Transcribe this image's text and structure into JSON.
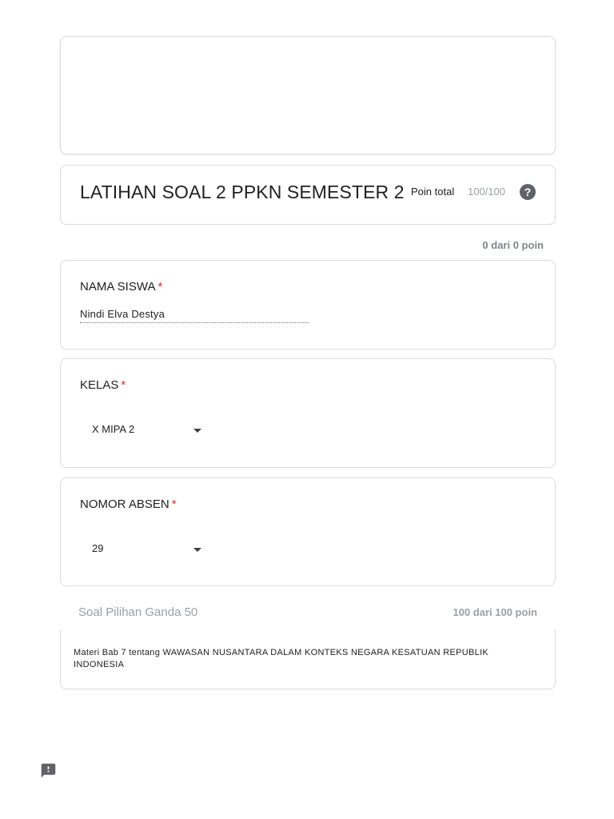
{
  "form": {
    "title": "LATIHAN SOAL 2 PPKN SEMESTER 2",
    "points_label": "Poin total",
    "points_value": "100/100",
    "help_glyph": "?",
    "score_summary": "0 dari 0 poin"
  },
  "questions": [
    {
      "title": "NAMA SISWA",
      "required_mark": "*",
      "type": "text",
      "answer": "Nindi Elva Destya"
    },
    {
      "title": "KELAS",
      "required_mark": "*",
      "type": "dropdown",
      "answer": "X MIPA 2"
    },
    {
      "title": "NOMOR ABSEN",
      "required_mark": "*",
      "type": "dropdown",
      "answer": "29"
    }
  ],
  "section": {
    "title": "Soal Pilihan Ganda 50",
    "points": "100 dari 100 poin",
    "description": "Materi Bab 7 tentang WAWASAN NUSANTARA DALAM KONTEKS NEGARA KESATUAN REPUBLIK INDONESIA"
  },
  "icons": {
    "help": "help-circle-icon",
    "dropdown": "caret-down-icon",
    "feedback": "report-feedback-icon"
  },
  "colors": {
    "required": "#d93025",
    "muted": "#9aa0a6",
    "border": "#dadce0"
  }
}
